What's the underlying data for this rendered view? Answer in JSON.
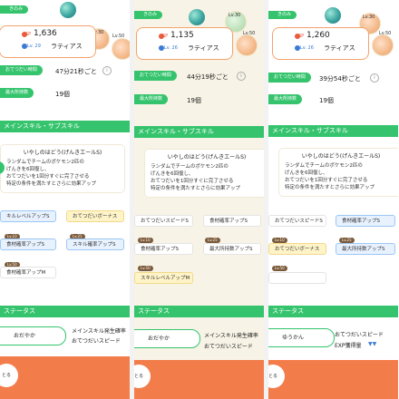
{
  "columns": [
    {
      "badge": "きのみ",
      "bubble_labels": [
        "Lv.30",
        "Lv.50"
      ],
      "sp_label": "SP",
      "sp_value": "1,636",
      "level": "Lv. 29",
      "pokemon_name": "ラティアス",
      "help_time_label": "おてつだい時間",
      "help_time_value": "47分21秒ごと",
      "inventory_label": "最大所持数",
      "inventory_value": "19個",
      "skill_section": "メインスキル・サブスキル",
      "skill_title": "いやしのはどう(げんきエールS)",
      "skill_lines": [
        "ランダムでチームのポケモン2匹の",
        "げんきを6回復し、",
        "おてつだいを1回分すぐに完了させる",
        "特定の条件を満たすとさらに効果アップ"
      ],
      "subskills": [
        {
          "label": "キルレベルアップS",
          "lv": "",
          "style": "blue"
        },
        {
          "label": "おてつだいボーナス",
          "lv": "",
          "style": "yellow"
        },
        {
          "label": "食材確率アップS",
          "lv": "Lv.10",
          "style": "blue"
        },
        {
          "label": "スキル確率アップS",
          "lv": "Lv.25",
          "style": "blue"
        },
        {
          "label": "食材確率アップM",
          "lv": "Lv.50",
          "style": "white"
        }
      ],
      "status_section": "ステータス",
      "nature": "おだやか",
      "stat_lines": [
        "メインスキル発生確率",
        "おてつだいスピード"
      ],
      "bottom_label": "とる"
    },
    {
      "badge": "きのみ",
      "bubble_labels": [
        "Lv.30",
        "Lv.50"
      ],
      "sp_label": "SP",
      "sp_value": "1,135",
      "level": "Lv. 26",
      "pokemon_name": "ラティアス",
      "help_time_label": "おてつだい時間",
      "help_time_value": "44分19秒ごと",
      "inventory_label": "最大所持数",
      "inventory_value": "19個",
      "skill_section": "メインスキル・サブスキル",
      "skill_title": "いやしのはどう(げんきエールS)",
      "skill_lines": [
        "ランダムでチームのポケモン2匹の",
        "げんきを6回復し、",
        "おてつだいを1回分すぐに完了させる",
        "特定の条件を満たすとさらに効果アップ"
      ],
      "subskills": [
        {
          "label": "おてつだいスピードS",
          "lv": "",
          "style": "white"
        },
        {
          "label": "食材確率アップS",
          "lv": "",
          "style": "white"
        },
        {
          "label": "食材確率アップS",
          "lv": "Lv.10",
          "style": "white"
        },
        {
          "label": "最大所持数アップS",
          "lv": "Lv.25",
          "style": "white"
        },
        {
          "label": "スキルレベルアップM",
          "lv": "Lv.50",
          "style": "yellow"
        }
      ],
      "status_section": "ステータス",
      "nature": "おだやか",
      "stat_lines": [
        "メインスキル発生確率",
        "おてつだいスピード"
      ],
      "bottom_label": "とる"
    },
    {
      "badge": "きのみ",
      "bubble_labels": [
        "Lv.30",
        "Lv.50"
      ],
      "sp_label": "SP",
      "sp_value": "1,260",
      "level": "Lv. 26",
      "pokemon_name": "ラティアス",
      "help_time_label": "おてつだい時間",
      "help_time_value": "39分54秒ごと",
      "inventory_label": "最大所持数",
      "inventory_value": "19個",
      "skill_section": "メインスキル・サブスキル",
      "skill_title": "いやしのはどう(げんきエールS)",
      "skill_lines": [
        "ランダムでチームのポケモン2匹の",
        "げんきを6回復し、",
        "おてつだいを1回分すぐに完了させる",
        "特定の条件を満たすとさらに効果アップ"
      ],
      "subskills": [
        {
          "label": "おてつだいスピードS",
          "lv": "",
          "style": "white"
        },
        {
          "label": "食材確率アップS",
          "lv": "",
          "style": "blue"
        },
        {
          "label": "おてつだいボーナス",
          "lv": "Lv.10",
          "style": "yellow"
        },
        {
          "label": "最大所持数アップS",
          "lv": "Lv.25",
          "style": "blue"
        },
        {
          "label": "",
          "lv": "Lv.50",
          "style": "white"
        }
      ],
      "status_section": "ステータス",
      "nature": "ゆうかん",
      "stat_lines": [
        "おてつだいスピード",
        "EXP獲得量"
      ],
      "bottom_label": "とる"
    }
  ],
  "colors": {
    "accent_green": "#35c46d",
    "bottom_orange": "#f37c4b"
  }
}
